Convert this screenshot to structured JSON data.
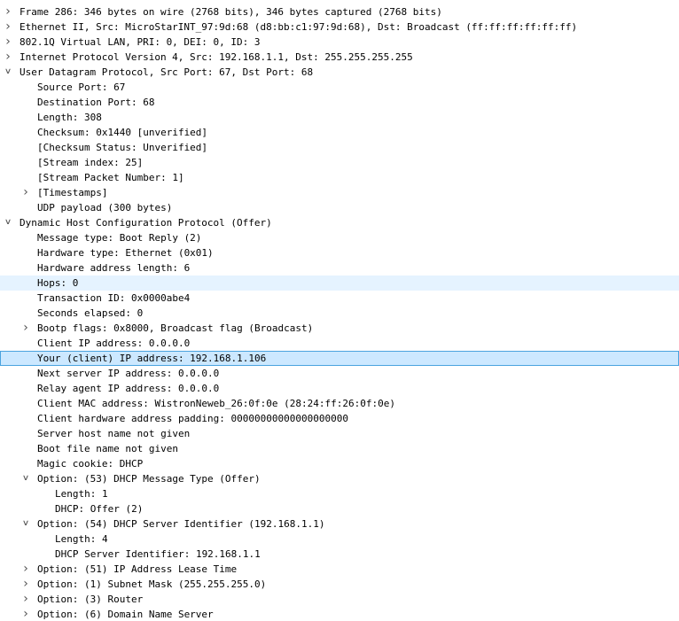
{
  "packet_details": [
    {
      "level": 0,
      "state": "collapsed",
      "text": "Frame 286: 346 bytes on wire (2768 bits), 346 bytes captured (2768 bits)"
    },
    {
      "level": 0,
      "state": "collapsed",
      "text": "Ethernet II, Src: MicroStarINT_97:9d:68 (d8:bb:c1:97:9d:68), Dst: Broadcast (ff:ff:ff:ff:ff:ff)"
    },
    {
      "level": 0,
      "state": "collapsed",
      "text": "802.1Q Virtual LAN, PRI: 0, DEI: 0, ID: 3"
    },
    {
      "level": 0,
      "state": "collapsed",
      "text": "Internet Protocol Version 4, Src: 192.168.1.1, Dst: 255.255.255.255"
    },
    {
      "level": 0,
      "state": "expanded",
      "text": "User Datagram Protocol, Src Port: 67, Dst Port: 68"
    },
    {
      "level": 1,
      "state": "leaf",
      "text": "Source Port: 67"
    },
    {
      "level": 1,
      "state": "leaf",
      "text": "Destination Port: 68"
    },
    {
      "level": 1,
      "state": "leaf",
      "text": "Length: 308"
    },
    {
      "level": 1,
      "state": "leaf",
      "text": "Checksum: 0x1440 [unverified]"
    },
    {
      "level": 1,
      "state": "leaf",
      "text": "[Checksum Status: Unverified]"
    },
    {
      "level": 1,
      "state": "leaf",
      "text": "[Stream index: 25]"
    },
    {
      "level": 1,
      "state": "leaf",
      "text": "[Stream Packet Number: 1]"
    },
    {
      "level": 1,
      "state": "collapsed",
      "text": "[Timestamps]"
    },
    {
      "level": 1,
      "state": "leaf",
      "text": "UDP payload (300 bytes)"
    },
    {
      "level": 0,
      "state": "expanded",
      "text": "Dynamic Host Configuration Protocol (Offer)"
    },
    {
      "level": 1,
      "state": "leaf",
      "text": "Message type: Boot Reply (2)"
    },
    {
      "level": 1,
      "state": "leaf",
      "text": "Hardware type: Ethernet (0x01)"
    },
    {
      "level": 1,
      "state": "leaf",
      "text": "Hardware address length: 6"
    },
    {
      "level": 1,
      "state": "leaf",
      "text": "Hops: 0",
      "highlight": "hover"
    },
    {
      "level": 1,
      "state": "leaf",
      "text": "Transaction ID: 0x0000abe4"
    },
    {
      "level": 1,
      "state": "leaf",
      "text": "Seconds elapsed: 0"
    },
    {
      "level": 1,
      "state": "collapsed",
      "text": "Bootp flags: 0x8000, Broadcast flag (Broadcast)"
    },
    {
      "level": 1,
      "state": "leaf",
      "text": "Client IP address: 0.0.0.0"
    },
    {
      "level": 1,
      "state": "leaf",
      "text": "Your (client) IP address: 192.168.1.106",
      "highlight": "selected"
    },
    {
      "level": 1,
      "state": "leaf",
      "text": "Next server IP address: 0.0.0.0"
    },
    {
      "level": 1,
      "state": "leaf",
      "text": "Relay agent IP address: 0.0.0.0"
    },
    {
      "level": 1,
      "state": "leaf",
      "text": "Client MAC address: WistronNeweb_26:0f:0e (28:24:ff:26:0f:0e)"
    },
    {
      "level": 1,
      "state": "leaf",
      "text": "Client hardware address padding: 00000000000000000000"
    },
    {
      "level": 1,
      "state": "leaf",
      "text": "Server host name not given"
    },
    {
      "level": 1,
      "state": "leaf",
      "text": "Boot file name not given"
    },
    {
      "level": 1,
      "state": "leaf",
      "text": "Magic cookie: DHCP"
    },
    {
      "level": 1,
      "state": "expanded",
      "text": "Option: (53) DHCP Message Type (Offer)"
    },
    {
      "level": 2,
      "state": "leaf",
      "text": "Length: 1"
    },
    {
      "level": 2,
      "state": "leaf",
      "text": "DHCP: Offer (2)"
    },
    {
      "level": 1,
      "state": "expanded",
      "text": "Option: (54) DHCP Server Identifier (192.168.1.1)"
    },
    {
      "level": 2,
      "state": "leaf",
      "text": "Length: 4"
    },
    {
      "level": 2,
      "state": "leaf",
      "text": "DHCP Server Identifier: 192.168.1.1"
    },
    {
      "level": 1,
      "state": "collapsed",
      "text": "Option: (51) IP Address Lease Time"
    },
    {
      "level": 1,
      "state": "collapsed",
      "text": "Option: (1) Subnet Mask (255.255.255.0)"
    },
    {
      "level": 1,
      "state": "collapsed",
      "text": "Option: (3) Router"
    },
    {
      "level": 1,
      "state": "collapsed",
      "text": "Option: (6) Domain Name Server"
    }
  ],
  "colors": {
    "hover_row": "#e5f3ff",
    "selected_row": "#cce8ff",
    "selected_border": "#4aa3df"
  }
}
